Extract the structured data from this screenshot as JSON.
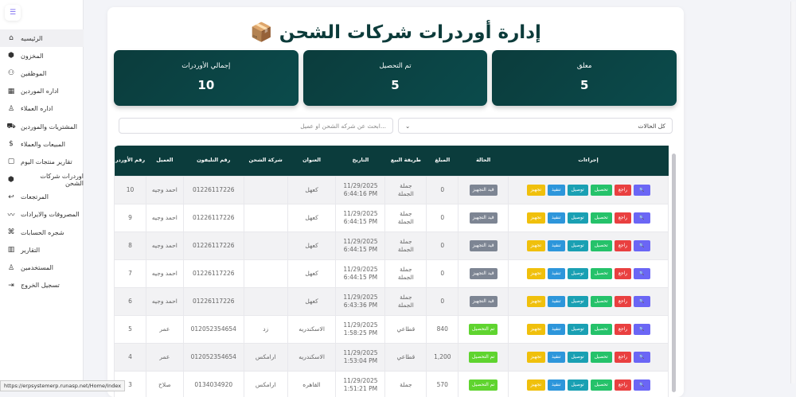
{
  "sidebar": {
    "items": [
      {
        "label": "الرئيسيه",
        "icon": "home-icon",
        "g": "⌂"
      },
      {
        "label": "المخزون",
        "icon": "box-icon",
        "g": "⬢"
      },
      {
        "label": "الموظفين",
        "icon": "users-icon",
        "g": "⚇"
      },
      {
        "label": "اداره الموردين",
        "icon": "store-icon",
        "g": "▦"
      },
      {
        "label": "اداره العملاء",
        "icon": "user-icon",
        "g": "♙"
      },
      {
        "label": "المشتريات والموردين",
        "icon": "cart-icon",
        "g": "⛟"
      },
      {
        "label": "المبيعات والعملاء",
        "icon": "dollar-icon",
        "g": "$"
      },
      {
        "label": "تقارير منتجات اليوم",
        "icon": "package-icon",
        "g": "▢"
      },
      {
        "label": "اوردرات شركات الشحن",
        "icon": "box-icon",
        "g": "⬢"
      },
      {
        "label": "المرتجعات",
        "icon": "return-icon",
        "g": "↩"
      },
      {
        "label": "المصروفات والايرادات",
        "icon": "trend-icon",
        "g": "〰"
      },
      {
        "label": "شجره الحسابات",
        "icon": "sitemap-icon",
        "g": "⌘"
      },
      {
        "label": "التقارير",
        "icon": "chart-icon",
        "g": "▥"
      },
      {
        "label": "المستخدمين",
        "icon": "user-icon",
        "g": "♙"
      },
      {
        "label": "تسجيل الخروج",
        "icon": "logout-icon",
        "g": "⇥"
      }
    ]
  },
  "title": "إدارة أوردرات شركات الشحن 📦",
  "stats": [
    {
      "label": "إجمالي الأوردرات",
      "value": "10"
    },
    {
      "label": "تم التحصيل",
      "value": "5"
    },
    {
      "label": "معلق",
      "value": "5"
    }
  ],
  "filters": {
    "search_placeholder": "...ابحث عن شركه الشحن او عميل",
    "status_value": "كل الحالات"
  },
  "table": {
    "headers": [
      "رقم الأوردر",
      "العميل",
      "رقم التليفون",
      "شركة الشحن",
      "العنوان",
      "التاريخ",
      "طريقة البيع",
      "المبلغ",
      "الحالة",
      "إجراءات"
    ],
    "rows": [
      {
        "id": "10",
        "customer": "احمد وجيه",
        "phone": "01226117226",
        "company": "",
        "address": "كعهل",
        "date": "11/29/2025",
        "time": "6:44:16 PM",
        "method": "جملة الجملة",
        "amount": "0",
        "status": "قيد التجهيز",
        "paid": false
      },
      {
        "id": "9",
        "customer": "احمد وجيه",
        "phone": "01226117226",
        "company": "",
        "address": "كعهل",
        "date": "11/29/2025",
        "time": "6:44:15 PM",
        "method": "جملة الجملة",
        "amount": "0",
        "status": "قيد التجهيز",
        "paid": false
      },
      {
        "id": "8",
        "customer": "احمد وجيه",
        "phone": "01226117226",
        "company": "",
        "address": "كعهل",
        "date": "11/29/2025",
        "time": "6:44:15 PM",
        "method": "جملة الجملة",
        "amount": "0",
        "status": "قيد التجهيز",
        "paid": false
      },
      {
        "id": "7",
        "customer": "احمد وجيه",
        "phone": "01226117226",
        "company": "",
        "address": "كعهل",
        "date": "11/29/2025",
        "time": "6:44:15 PM",
        "method": "جملة الجملة",
        "amount": "0",
        "status": "قيد التجهيز",
        "paid": false
      },
      {
        "id": "6",
        "customer": "احمد وجيه",
        "phone": "01226117226",
        "company": "",
        "address": "كعهل",
        "date": "11/29/2025",
        "time": "6:43:36 PM",
        "method": "جملة الجملة",
        "amount": "0",
        "status": "قيد التجهيز",
        "paid": false
      },
      {
        "id": "5",
        "customer": "عمر",
        "phone": "012052354654",
        "company": "زد",
        "address": "الاسكندريه",
        "date": "11/29/2025",
        "time": "1:58:25 PM",
        "method": "قطاعي",
        "amount": "840",
        "status": "تم التحصيل",
        "paid": true
      },
      {
        "id": "4",
        "customer": "عمر",
        "phone": "012052354654",
        "company": "ارامكس",
        "address": "الاسكندريه",
        "date": "11/29/2025",
        "time": "1:53:04 PM",
        "method": "قطاعي",
        "amount": "1,200",
        "status": "تم التحصيل",
        "paid": true
      },
      {
        "id": "3",
        "customer": "صلاح",
        "phone": "0134034920",
        "company": "ارامكس",
        "address": "القاهره",
        "date": "11/29/2025",
        "time": "1:51:21 PM",
        "method": "جملة",
        "amount": "570",
        "status": "تم التحصيل",
        "paid": true
      }
    ]
  },
  "actions": [
    {
      "label": "تجهيز",
      "color": "#f0c00c"
    },
    {
      "label": "تنفيذ",
      "color": "#2d96db"
    },
    {
      "label": "توصيل",
      "color": "#1aa0b3"
    },
    {
      "label": "تحصيل",
      "color": "#25c26a"
    },
    {
      "label": "راجع",
      "color": "#e94040"
    },
    {
      "label": "🔍",
      "color": "#6b66f5"
    }
  ],
  "colors": {
    "pending": "#7d8593",
    "paid": "#5fd42f",
    "header": "#0b3c3c"
  },
  "status_url": "https://erpsystemerp.runasp.net/Home/Index"
}
